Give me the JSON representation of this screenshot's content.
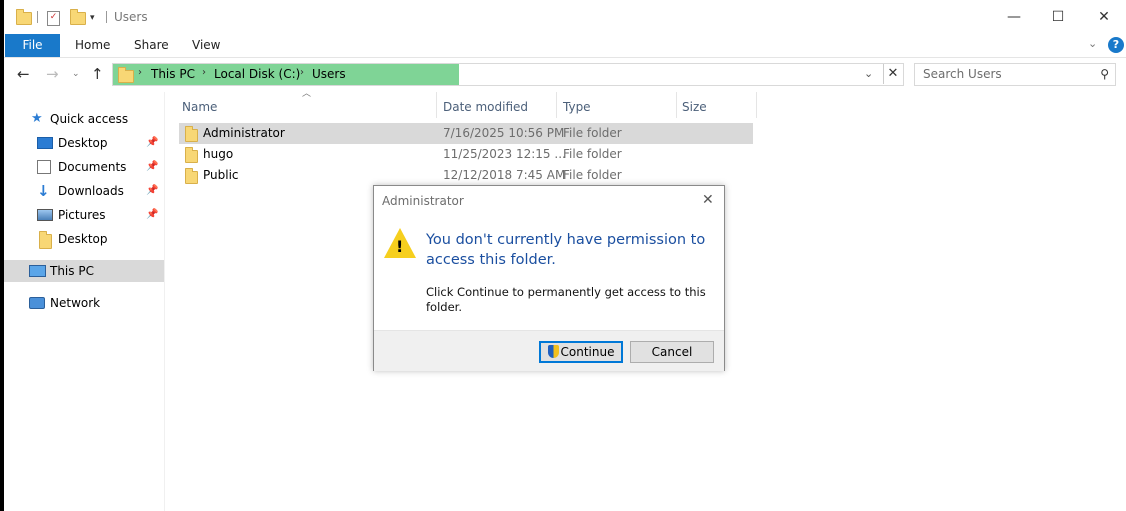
{
  "window": {
    "title": "Users",
    "controls": {
      "minimize": "—",
      "maximize": "☐",
      "close": "✕"
    }
  },
  "ribbon": {
    "file_tab": "File",
    "tabs": [
      "Home",
      "Share",
      "View"
    ],
    "help": "?"
  },
  "address": {
    "crumbs": [
      "This PC",
      "Local Disk (C:)",
      "Users"
    ],
    "separator": "›"
  },
  "search": {
    "placeholder": "Search Users"
  },
  "sidebar": {
    "items": [
      {
        "label": "Quick access",
        "icon": "star-icon",
        "pinned": false
      },
      {
        "label": "Desktop",
        "icon": "desktop-icon",
        "pinned": true
      },
      {
        "label": "Documents",
        "icon": "documents-icon",
        "pinned": true
      },
      {
        "label": "Downloads",
        "icon": "downloads-icon",
        "pinned": true
      },
      {
        "label": "Pictures",
        "icon": "pictures-icon",
        "pinned": true
      },
      {
        "label": "Desktop",
        "icon": "folder-icon",
        "pinned": false
      },
      {
        "label": "This PC",
        "icon": "computer-icon",
        "pinned": false
      },
      {
        "label": "Network",
        "icon": "network-icon",
        "pinned": false
      }
    ]
  },
  "columns": [
    "Name",
    "Date modified",
    "Type",
    "Size"
  ],
  "files": [
    {
      "name": "Administrator",
      "date": "7/16/2025 10:56 PM",
      "type": "File folder",
      "size": ""
    },
    {
      "name": "hugo",
      "date": "11/25/2023 12:15 ...",
      "type": "File folder",
      "size": ""
    },
    {
      "name": "Public",
      "date": "12/12/2018 7:45 AM",
      "type": "File folder",
      "size": ""
    }
  ],
  "dialog": {
    "title": "Administrator",
    "close": "✕",
    "message": "You don't currently have permission to access this folder.",
    "detail": "Click Continue to permanently get access to this folder.",
    "continue_label": "Continue",
    "cancel_label": "Cancel"
  },
  "colors": {
    "accent": "#1979ca",
    "address_highlight": "#7fd496",
    "dialog_heading": "#1b4fa0",
    "selection": "#d9d9d9"
  }
}
